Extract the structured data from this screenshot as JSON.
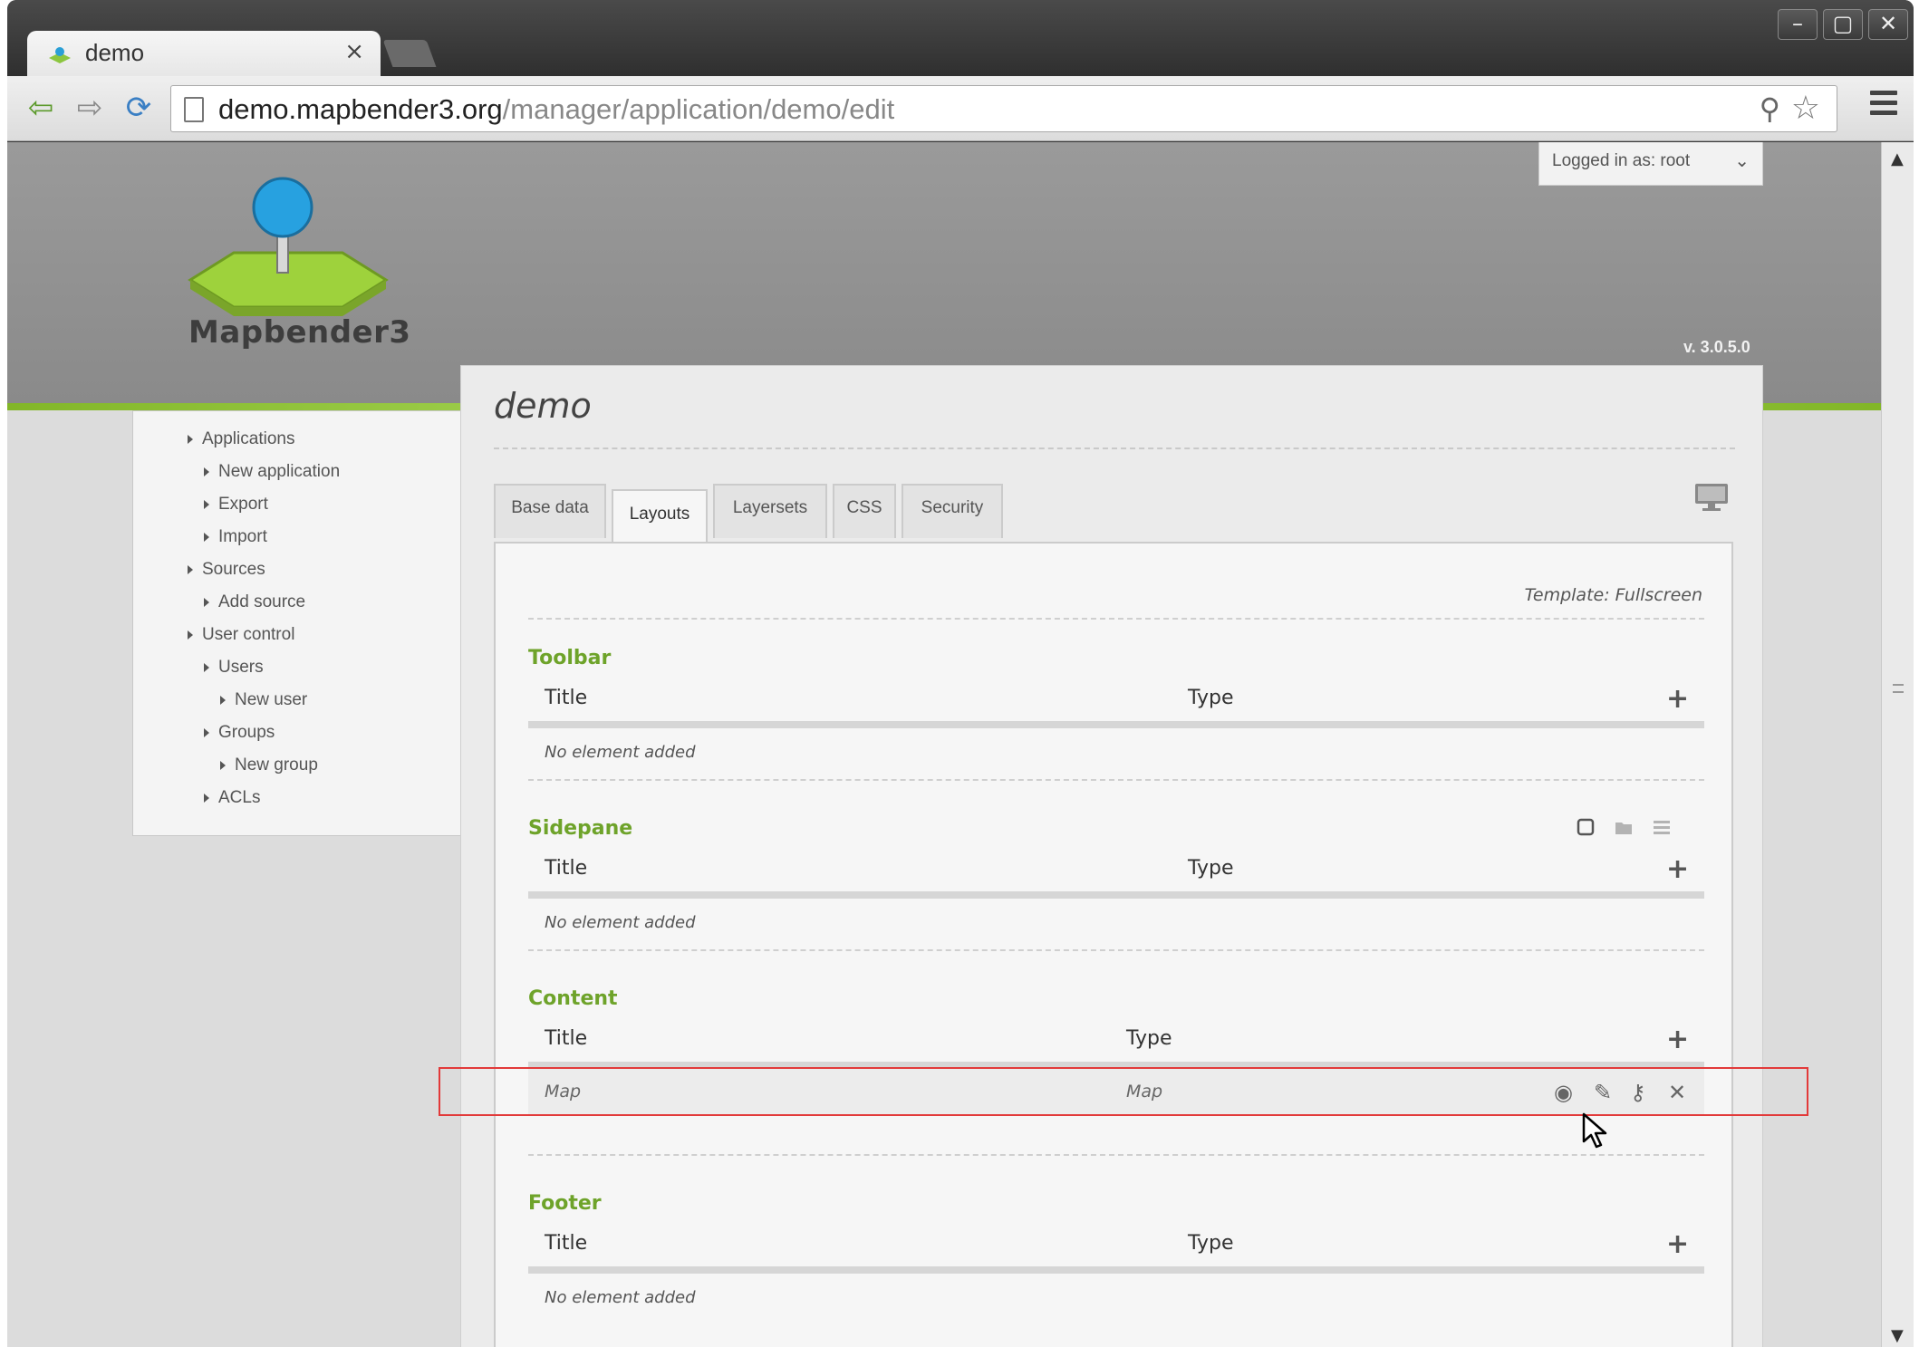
{
  "browser": {
    "tab_title": "demo",
    "tab_close": "×",
    "window_min": "–",
    "window_max": "▢",
    "window_close": "✕",
    "url_host": "demo.mapbender3.org",
    "url_path": "/manager/application/demo/edit"
  },
  "header": {
    "logo_text": "Mapbender3",
    "user_menu": "Logged in as: root",
    "version": "v. 3.0.5.0"
  },
  "sidebar": {
    "items": [
      {
        "label": "Applications"
      },
      {
        "label": "New application"
      },
      {
        "label": "Export"
      },
      {
        "label": "Import"
      },
      {
        "label": "Sources"
      },
      {
        "label": "Add source"
      },
      {
        "label": "User control"
      },
      {
        "label": "Users"
      },
      {
        "label": "New user"
      },
      {
        "label": "Groups"
      },
      {
        "label": "New group"
      },
      {
        "label": "ACLs"
      }
    ]
  },
  "main": {
    "title": "demo",
    "tabs": [
      {
        "label": "Base data"
      },
      {
        "label": "Layouts"
      },
      {
        "label": "Layersets"
      },
      {
        "label": "CSS"
      },
      {
        "label": "Security"
      }
    ],
    "active_tab": "Layouts",
    "template_label": "Template: Fullscreen",
    "sections": [
      {
        "name": "Toolbar",
        "col_title": "Title",
        "col_type": "Type",
        "empty_text": "No element added"
      },
      {
        "name": "Sidepane",
        "col_title": "Title",
        "col_type": "Type",
        "empty_text": "No element added"
      },
      {
        "name": "Content",
        "col_title": "Title",
        "col_type": "Type",
        "rows": [
          {
            "title": "Map",
            "type": "Map"
          }
        ]
      },
      {
        "name": "Footer",
        "col_title": "Title",
        "col_type": "Type",
        "empty_text": "No element added"
      }
    ]
  },
  "colors": {
    "accent_green": "#6ea32a",
    "header_gray": "#8f8f8f",
    "highlight_red": "#e23a3a"
  }
}
